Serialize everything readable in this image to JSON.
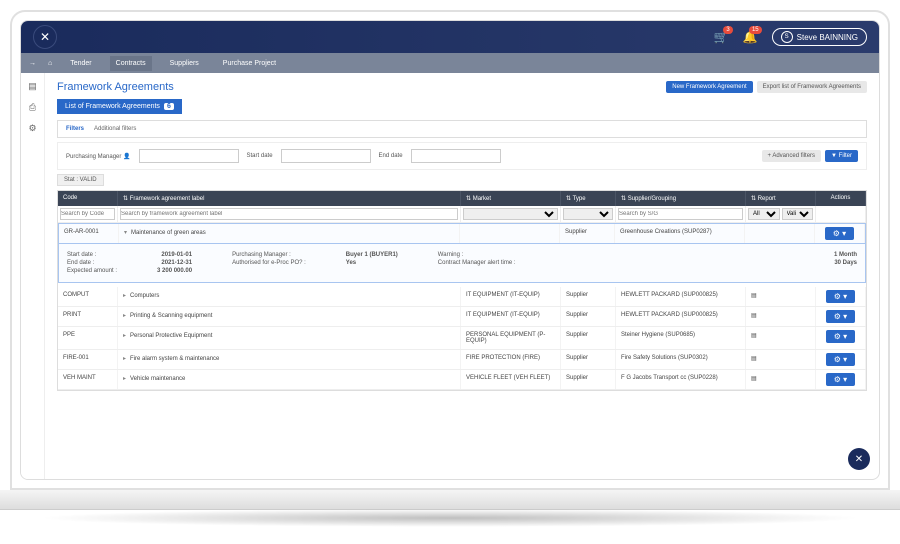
{
  "header": {
    "cart_badge": "3",
    "bell_badge": "15",
    "user_initial": "S",
    "user_name": "Steve BAINNING"
  },
  "nav": {
    "items": [
      "Tender",
      "Contracts",
      "Suppliers",
      "Purchase Project"
    ],
    "active": "Contracts"
  },
  "page": {
    "title": "Framework Agreements",
    "new_btn": "New Framework Agreement",
    "export_btn": "Export list of Framework Agreements",
    "tab_label": "List of Framework Agreements",
    "tab_count": "6"
  },
  "filters": {
    "tab1": "Filters",
    "tab2": "Additional filters",
    "pm_label": "Purchasing Manager",
    "start_label": "Start date",
    "end_label": "End date",
    "adv_btn": "Advanced filters",
    "filter_btn": "Filter",
    "stat": "Stat : VALID"
  },
  "table": {
    "headers": {
      "code": "Code",
      "label": "Framework agreement label",
      "market": "Market",
      "type": "Type",
      "supplier": "Supplier/Grouping",
      "report": "Report",
      "actions": "Actions"
    },
    "search": {
      "code_ph": "Search by Code",
      "label_ph": "Search by framework agreement label",
      "sup_ph": "Search by S/G",
      "rep_all": "All",
      "rep_valid": "Valid"
    },
    "rows": [
      {
        "code": "GR-AR-0001",
        "label": "Maintenance of green areas",
        "market": "",
        "type": "Supplier",
        "supplier": "Greenhouse Creations (SUP0287)",
        "expanded": true
      },
      {
        "code": "COMPUT",
        "label": "Computers",
        "market": "IT EQUIPMENT (IT-EQUIP)",
        "type": "Supplier",
        "supplier": "HEWLETT PACKARD (SUP000825)"
      },
      {
        "code": "PRINT",
        "label": "Printing & Scanning equipment",
        "market": "IT EQUIPMENT (IT-EQUIP)",
        "type": "Supplier",
        "supplier": "HEWLETT PACKARD (SUP000825)"
      },
      {
        "code": "PPE",
        "label": "Personal Protective Equipment",
        "market": "PERSONAL EQUIPMENT (P-EQUIP)",
        "type": "Supplier",
        "supplier": "Steiner Hygiene (SUP0685)"
      },
      {
        "code": "FIRE-001",
        "label": "Fire alarm system & maintenance",
        "market": "FIRE PROTECTION (FIRE)",
        "type": "Supplier",
        "supplier": "Fire Safety Solutions (SUP0302)"
      },
      {
        "code": "VEH MAINT",
        "label": "Vehicle maintenance",
        "market": "VEHICLE FLEET (VEH FLEET)",
        "type": "Supplier",
        "supplier": "F G Jacobs Transport cc (SUP0228)"
      }
    ],
    "detail": {
      "start_lbl": "Start date :",
      "start_val": "2019-01-01",
      "end_lbl": "End date :",
      "end_val": "2021-12-31",
      "exp_lbl": "Expected amount :",
      "exp_val": "3 200 000.00",
      "pm_lbl": "Purchasing Manager :",
      "pm_val": "Buyer 1 (BUYER1)",
      "auth_lbl": "Authorised for e-Proc PO? :",
      "auth_val": "Yes",
      "warn_lbl": "Warning :",
      "warn_val": "1 Month",
      "alert_lbl": "Contract Manager alert time :",
      "alert_val": "30 Days"
    }
  }
}
